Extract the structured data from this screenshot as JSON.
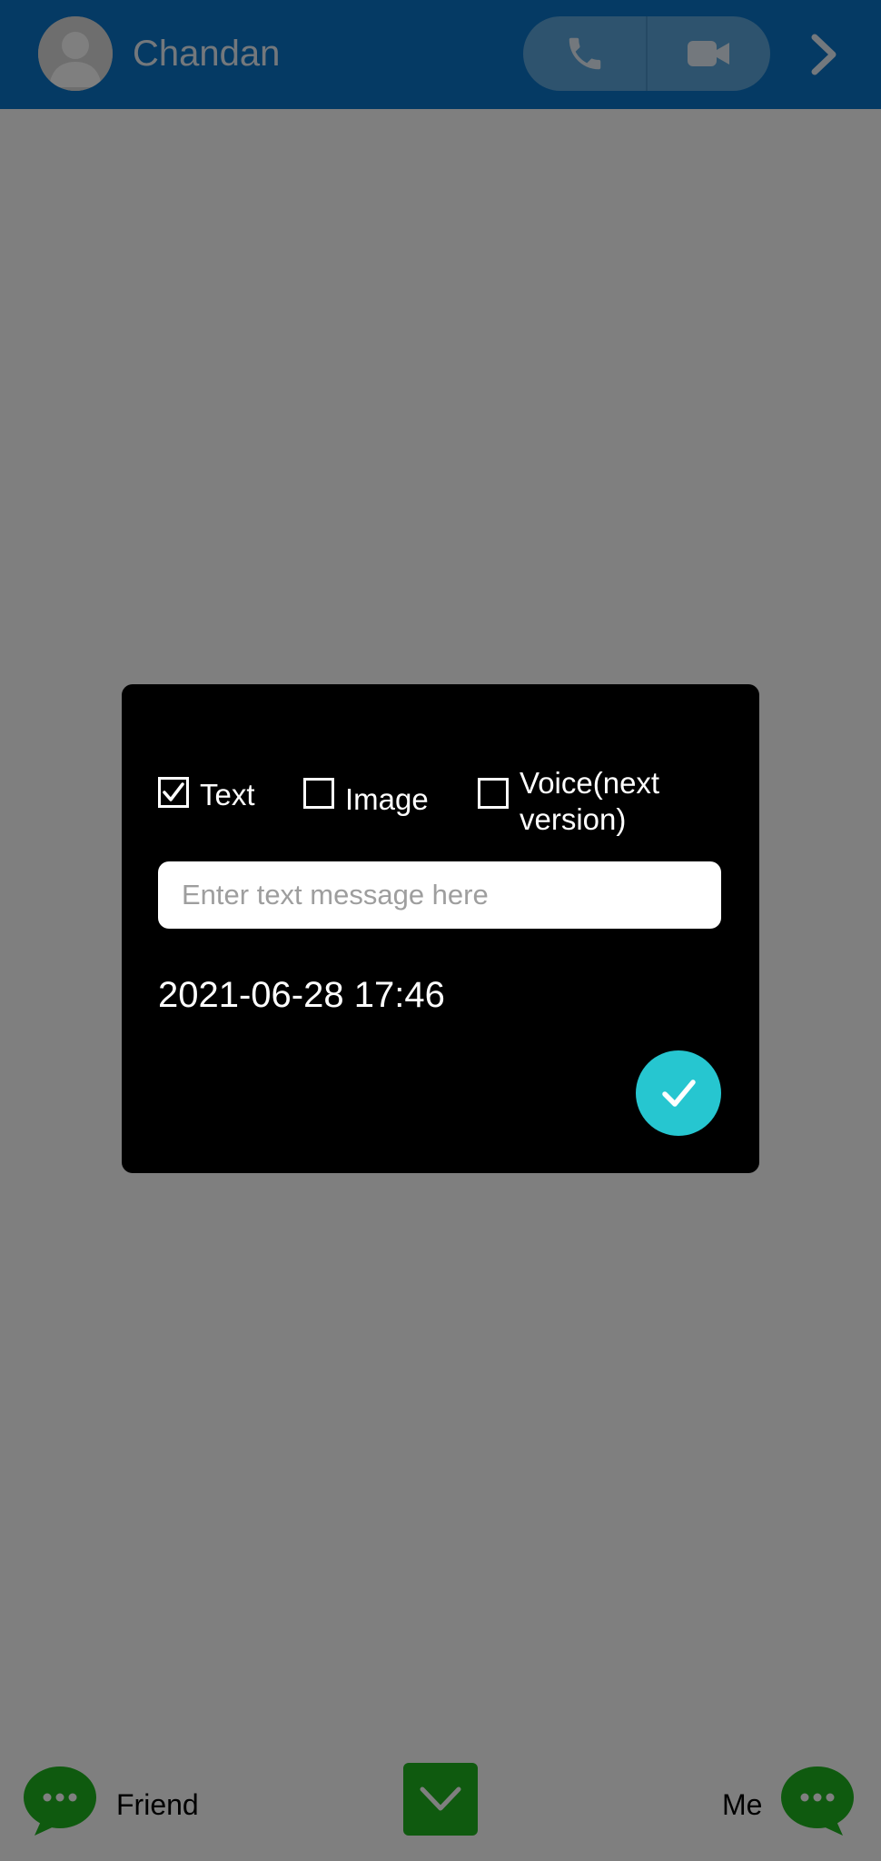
{
  "header": {
    "contact_name": "Chandan",
    "avatar_icon": "person-avatar-icon",
    "voice_call_icon": "phone-icon",
    "video_call_icon": "video-camera-icon",
    "next_icon": "chevron-right-icon"
  },
  "dialog": {
    "options": [
      {
        "label": "Text",
        "checked": true
      },
      {
        "label": "Image",
        "checked": false
      },
      {
        "label": "Voice(next version)",
        "checked": false
      }
    ],
    "input": {
      "placeholder": "Enter text message here",
      "value": ""
    },
    "datetime": "2021-06-28 17:46",
    "confirm_icon": "checkmark-icon"
  },
  "bottom_bar": {
    "friend_label": "Friend",
    "me_label": "Me",
    "friend_icon": "chat-bubble-icon",
    "me_icon": "chat-bubble-icon",
    "scroll_down_icon": "chevron-down-icon"
  },
  "colors": {
    "header_bg": "#0b74c8",
    "overlay": "rgba(0,0,0,0.5)",
    "dialog_bg": "#000000",
    "confirm_bg": "#26c6d0",
    "bubble_green": "#1fb41f"
  }
}
